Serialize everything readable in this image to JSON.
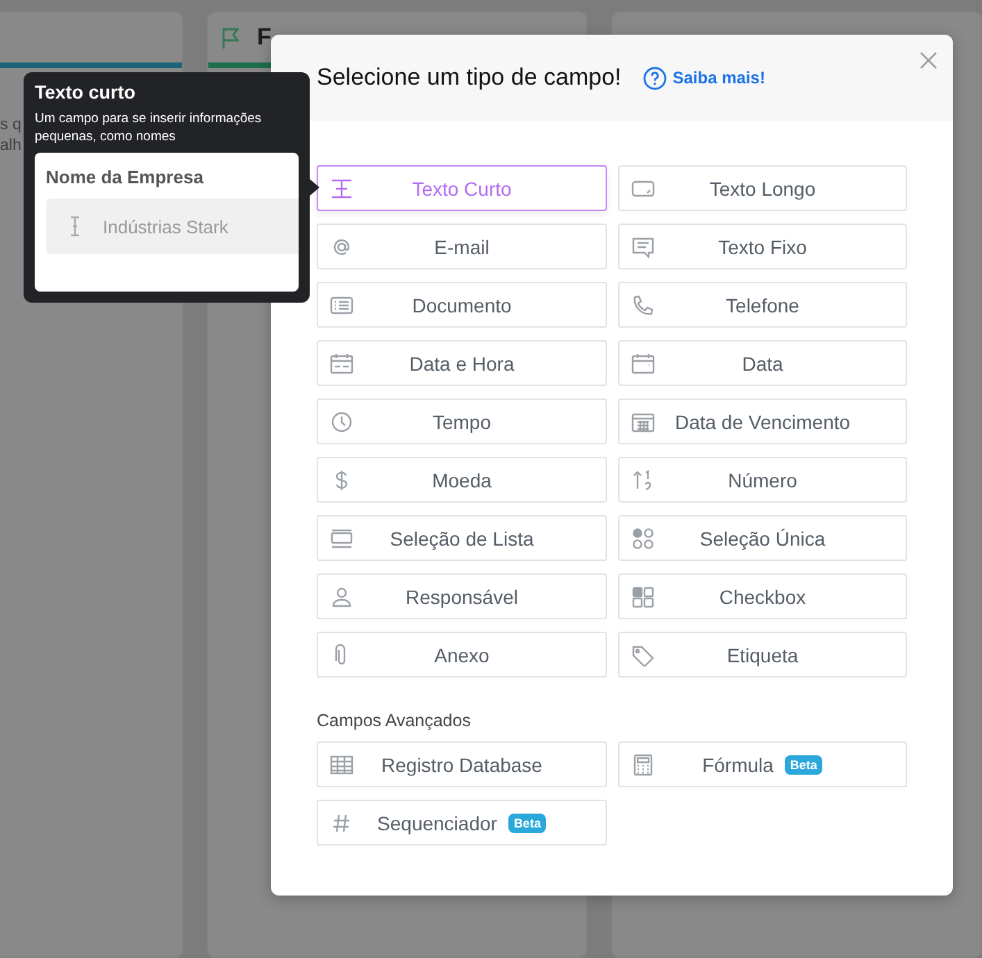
{
  "board": {
    "columns": [
      {
        "color": "#1d6376",
        "snippets": [
          "s q",
          "alh"
        ]
      },
      {
        "title": "F",
        "color": "#1c6e4c"
      },
      {}
    ]
  },
  "tooltip": {
    "title": "Texto curto",
    "description": "Um campo para se inserir informações pequenas, como nomes",
    "preview_label": "Nome da Empresa",
    "preview_placeholder": "Indústrias Stark"
  },
  "modal": {
    "title": "Selecione um tipo de campo!",
    "help_link": "Saiba mais!",
    "fields": [
      {
        "label": "Texto Curto",
        "kind": "cursor",
        "selected": true
      },
      {
        "label": "Texto Longo",
        "kind": "textarea",
        "selected": false
      },
      {
        "label": "E-mail",
        "kind": "at",
        "selected": false
      },
      {
        "label": "Texto Fixo",
        "kind": "message",
        "selected": false
      },
      {
        "label": "Documento",
        "kind": "document",
        "selected": false
      },
      {
        "label": "Telefone",
        "kind": "phone",
        "selected": false
      },
      {
        "label": "Data e Hora",
        "kind": "datetime",
        "selected": false
      },
      {
        "label": "Data",
        "kind": "date",
        "selected": false
      },
      {
        "label": "Tempo",
        "kind": "clock",
        "selected": false
      },
      {
        "label": "Data de Vencimento",
        "kind": "calendar",
        "selected": false
      },
      {
        "label": "Moeda",
        "kind": "currency",
        "selected": false
      },
      {
        "label": "Número",
        "kind": "number",
        "selected": false
      },
      {
        "label": "Seleção de Lista",
        "kind": "list",
        "selected": false
      },
      {
        "label": "Seleção Única",
        "kind": "radio",
        "selected": false
      },
      {
        "label": "Responsável",
        "kind": "person",
        "selected": false
      },
      {
        "label": "Checkbox",
        "kind": "checkbox",
        "selected": false
      },
      {
        "label": "Anexo",
        "kind": "paperclip",
        "selected": false
      },
      {
        "label": "Etiqueta",
        "kind": "tag",
        "selected": false
      }
    ],
    "advanced_title": "Campos Avançados",
    "advanced_fields": [
      {
        "label": "Registro Database",
        "kind": "table",
        "selected": false
      },
      {
        "label": "Fórmula",
        "kind": "calculator",
        "selected": false,
        "badge": "Beta"
      },
      {
        "label": "Sequenciador",
        "kind": "hash",
        "selected": false,
        "badge": "Beta"
      }
    ]
  }
}
